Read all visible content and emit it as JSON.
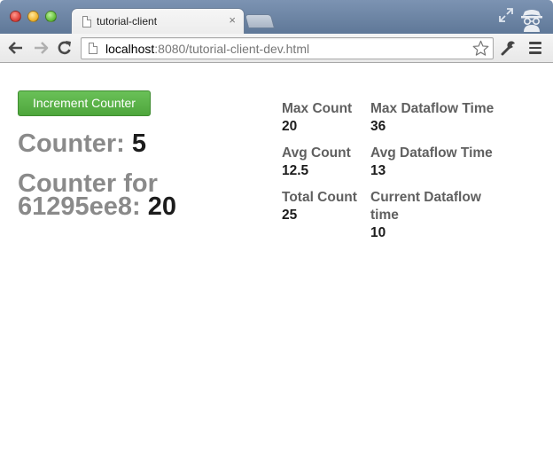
{
  "browser": {
    "tab_title": "tutorial-client",
    "tab_close": "×",
    "url_host": "localhost",
    "url_rest": ":8080/tutorial-client-dev.html"
  },
  "page": {
    "increment_button": "Increment Counter",
    "counter_label": "Counter:",
    "counter_value": "5",
    "counter_for_label": "Counter for 61295ee8:",
    "counter_for_value": "20"
  },
  "stats": {
    "max_count": {
      "label": "Max Count",
      "value": "20"
    },
    "avg_count": {
      "label": "Avg Count",
      "value": "12.5"
    },
    "total_count": {
      "label": "Total Count",
      "value": "25"
    },
    "max_dataflow": {
      "label": "Max Dataflow Time",
      "value": "36"
    },
    "avg_dataflow": {
      "label": "Avg Dataflow Time",
      "value": "13"
    },
    "current_dataflow": {
      "label": "Current Dataflow time",
      "value": "10"
    }
  },
  "icons": {
    "close": "close-icon",
    "minimize": "minimize-icon",
    "zoom": "zoom-icon",
    "back": "back-arrow-icon",
    "forward": "forward-arrow-icon",
    "reload": "reload-icon",
    "bookmark": "star-icon",
    "wrench": "wrench-icon",
    "menu": "menu-icon",
    "incognito": "incognito-icon",
    "fullscreen": "fullscreen-icon"
  },
  "colors": {
    "button_green": "#5cb449",
    "label_gray": "#8a8a8a",
    "value_dark": "#1c1c1c"
  }
}
